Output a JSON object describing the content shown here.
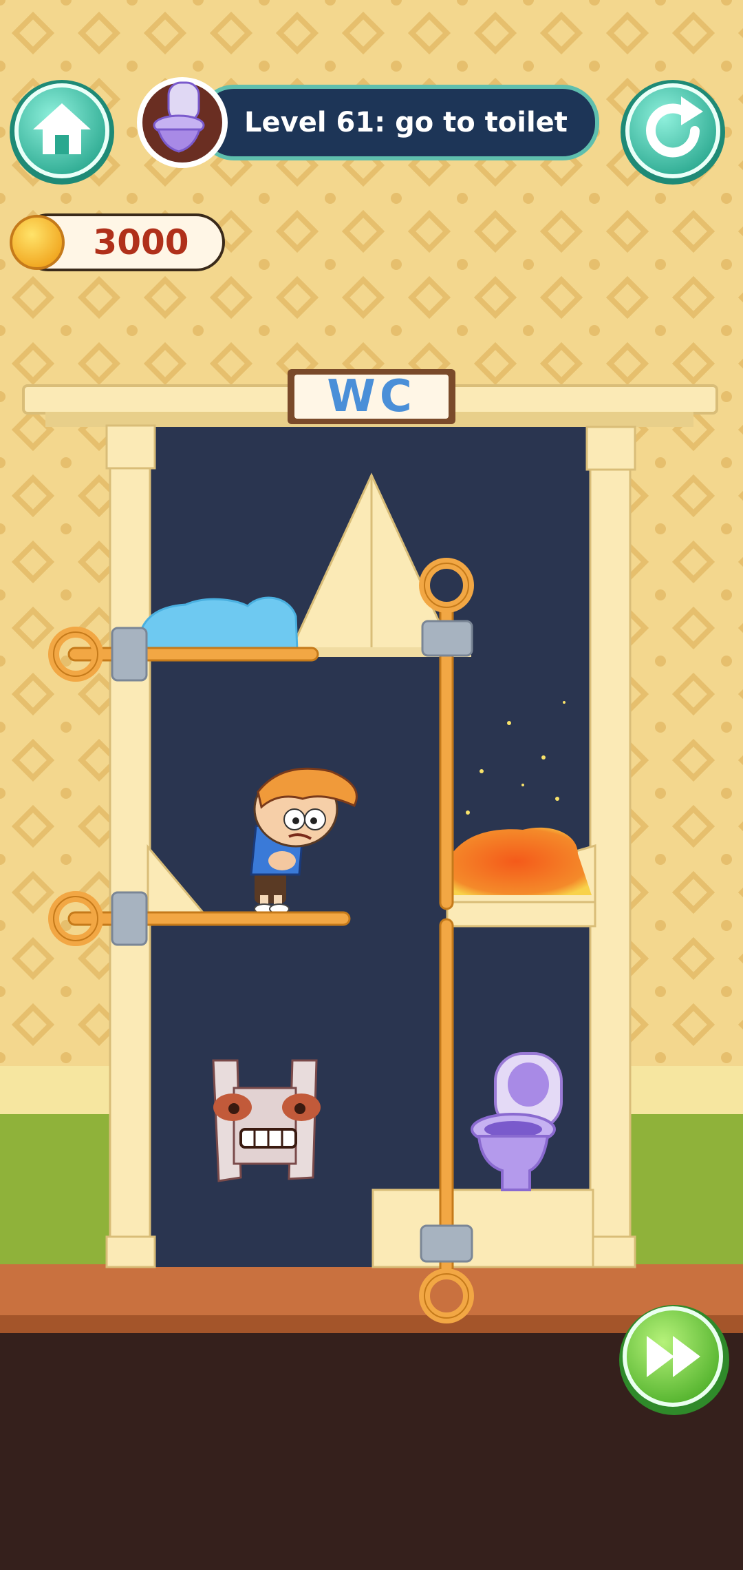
{
  "hud": {
    "level_title": "Level 61: go to toilet",
    "coins": "3000",
    "home_icon": "home-icon",
    "restart_icon": "restart-icon",
    "skip_icon": "fast-forward-icon",
    "level_badge_icon": "toilet-icon"
  },
  "scene": {
    "door_sign": "WC",
    "pins": [
      {
        "name": "top-left-pin",
        "orientation": "horizontal"
      },
      {
        "name": "middle-left-pin",
        "orientation": "horizontal"
      },
      {
        "name": "top-right-vertical-pin",
        "orientation": "vertical"
      },
      {
        "name": "bottom-right-vertical-pin",
        "orientation": "vertical"
      }
    ],
    "elements": [
      "water",
      "lava",
      "boy",
      "paper-monster",
      "toilet"
    ]
  },
  "colors": {
    "wallpaper": "#f3d78e",
    "door_frame": "#fbeab6",
    "room_background": "#2a3550",
    "pin": "#f2a744",
    "water": "#6ec9f1",
    "lava": "#f06a1d",
    "floor": "#c9713f",
    "bottom_area": "#35201c",
    "hud_button": "#5fd2b8",
    "skip_button": "#7bd64a",
    "title_bar": "#1d3557"
  }
}
